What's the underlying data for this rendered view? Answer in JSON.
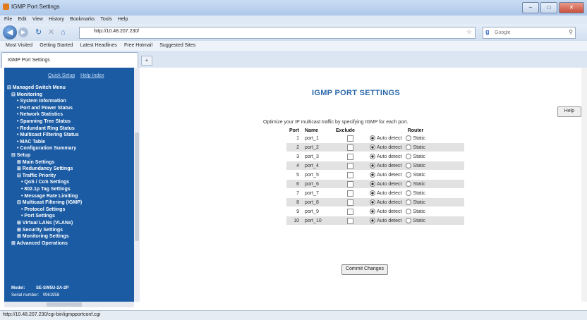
{
  "window": {
    "title": "IGMP Port Settings",
    "buttons": [
      "–",
      "□",
      "✕"
    ]
  },
  "menu": [
    "File",
    "Edit",
    "View",
    "History",
    "Bookmarks",
    "Tools",
    "Help"
  ],
  "nav": {
    "url": "http://10.48.207.230/",
    "search_engine": "Google"
  },
  "bookmarks": [
    "Most Visited",
    "Getting Started",
    "Latest Headlines",
    "Free Hotmail",
    "Suggested Sites"
  ],
  "tab": {
    "label": "IGMP Port Settings",
    "new_tab": "+"
  },
  "sidebar": {
    "links": [
      "Quick Setup",
      "Help Index"
    ],
    "items": [
      {
        "label": "⊟ Managed Switch Menu",
        "indent": 0
      },
      {
        "label": "⊟ Monitoring",
        "indent": 1
      },
      {
        "label": "• System Information",
        "indent": 2
      },
      {
        "label": "• Port and Power Status",
        "indent": 2
      },
      {
        "label": "• Network Statistics",
        "indent": 2
      },
      {
        "label": "• Spanning Tree Status",
        "indent": 2
      },
      {
        "label": "• Redundant Ring Status",
        "indent": 2
      },
      {
        "label": "• Multicast Filtering Status",
        "indent": 2
      },
      {
        "label": "• MAC Table",
        "indent": 2
      },
      {
        "label": "• Configuration Summary",
        "indent": 2
      },
      {
        "label": "⊟ Setup",
        "indent": 1
      },
      {
        "label": "⊞ Main Settings",
        "indent": 2
      },
      {
        "label": "⊞ Redundancy Settings",
        "indent": 2
      },
      {
        "label": "⊟ Traffic Priority",
        "indent": 2
      },
      {
        "label": "• QoS / CoS Settings",
        "indent": 3
      },
      {
        "label": "• 802.1p Tag Settings",
        "indent": 3
      },
      {
        "label": "• Message Rate Limiting",
        "indent": 3
      },
      {
        "label": "⊟ Multicast Filtering (IGMP)",
        "indent": 2
      },
      {
        "label": "• Protocol Settings",
        "indent": 3
      },
      {
        "label": "• Port Settings",
        "indent": 3
      },
      {
        "label": "⊞ Virtual LANs (VLANs)",
        "indent": 2
      },
      {
        "label": "⊞ Security Settings",
        "indent": 2
      },
      {
        "label": "⊞ Monitoring Settings",
        "indent": 2
      },
      {
        "label": "⊞ Advanced Operations",
        "indent": 1
      }
    ],
    "model_label": "Model:",
    "model_value": "SE-SW5U-2A-2P",
    "serial_label": "Serial number:",
    "serial_value": "0961958"
  },
  "main": {
    "title": "IGMP PORT SETTINGS",
    "help_button": "Help",
    "intro": "Optimize your IP multicast traffic by specifying IGMP for each port.",
    "headers": {
      "port": "Port",
      "name": "Name",
      "exclude": "Exclude",
      "router": "Router"
    },
    "router_options": {
      "auto": "Auto detect",
      "static": "Static"
    },
    "ports": [
      {
        "port": "1",
        "name": "port_1",
        "exclude": false,
        "router": "auto"
      },
      {
        "port": "2",
        "name": "port_2",
        "exclude": false,
        "router": "auto"
      },
      {
        "port": "3",
        "name": "port_3",
        "exclude": false,
        "router": "auto"
      },
      {
        "port": "4",
        "name": "port_4",
        "exclude": false,
        "router": "auto"
      },
      {
        "port": "5",
        "name": "port_5",
        "exclude": false,
        "router": "auto"
      },
      {
        "port": "6",
        "name": "port_6",
        "exclude": false,
        "router": "auto"
      },
      {
        "port": "7",
        "name": "port_7",
        "exclude": false,
        "router": "auto"
      },
      {
        "port": "8",
        "name": "port_8",
        "exclude": false,
        "router": "auto"
      },
      {
        "port": "9",
        "name": "port_9",
        "exclude": false,
        "router": "auto"
      },
      {
        "port": "10",
        "name": "port_10",
        "exclude": false,
        "router": "auto"
      }
    ],
    "commit_button": "Commit Changes"
  },
  "status_bar": "http://10.48.207.230/cgi-bin/igmpportconf.cgi",
  "colors": {
    "sidebar_bg": "#1a5ba4",
    "title": "#2967ab",
    "alt_row": "#e2e2e2"
  }
}
